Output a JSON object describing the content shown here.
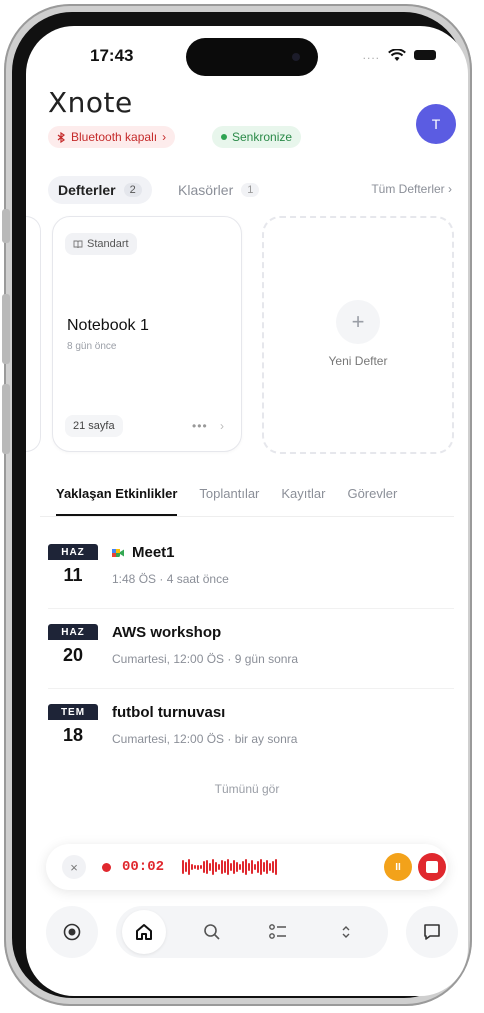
{
  "status": {
    "time": "17:43",
    "signal": "....",
    "wifi_icon": "wifi-icon",
    "battery_icon": "battery-icon"
  },
  "header": {
    "logo": "Xnote",
    "avatar_initial": "T",
    "bluetooth_label": "Bluetooth kapalı",
    "bluetooth_chevron": "›",
    "sync_label": "Senkronize"
  },
  "notebooks_tabs": {
    "notebooks_label": "Defterler",
    "notebooks_count": "2",
    "folders_label": "Klasörler",
    "folders_count": "1",
    "all_link": "Tüm Defterler ›"
  },
  "notebook_card": {
    "tag": "Standart",
    "title": "Notebook 1",
    "subtitle": "8 gün önce",
    "pages": "21 sayfa",
    "more": "•••",
    "chevron": "›"
  },
  "new_card": {
    "plus": "+",
    "label": "Yeni Defter"
  },
  "event_tabs": [
    "Yaklaşan Etkinlikler",
    "Toplantılar",
    "Kayıtlar",
    "Görevler"
  ],
  "events": [
    {
      "month": "HAZ",
      "day": "11",
      "title": "Meet1",
      "subtitle": "1:48 ÖS · 4 saat önce",
      "has_meet_icon": true
    },
    {
      "month": "HAZ",
      "day": "20",
      "title": "AWS workshop",
      "subtitle": "Cumartesi, 12:00 ÖS · 9 gün sonra",
      "has_meet_icon": false
    },
    {
      "month": "TEM",
      "day": "18",
      "title": "futbol turnuvası",
      "subtitle": "Cumartesi, 12:00 ÖS · bir ay sonra",
      "has_meet_icon": false
    }
  ],
  "see_all": "Tümünü gör",
  "recording": {
    "close": "×",
    "time": "00:02",
    "pause": "II"
  },
  "colors": {
    "accent_red": "#e0282e",
    "pause_orange": "#f3a21a",
    "avatar": "#5b5ce2",
    "date_dark": "#1e2437"
  }
}
